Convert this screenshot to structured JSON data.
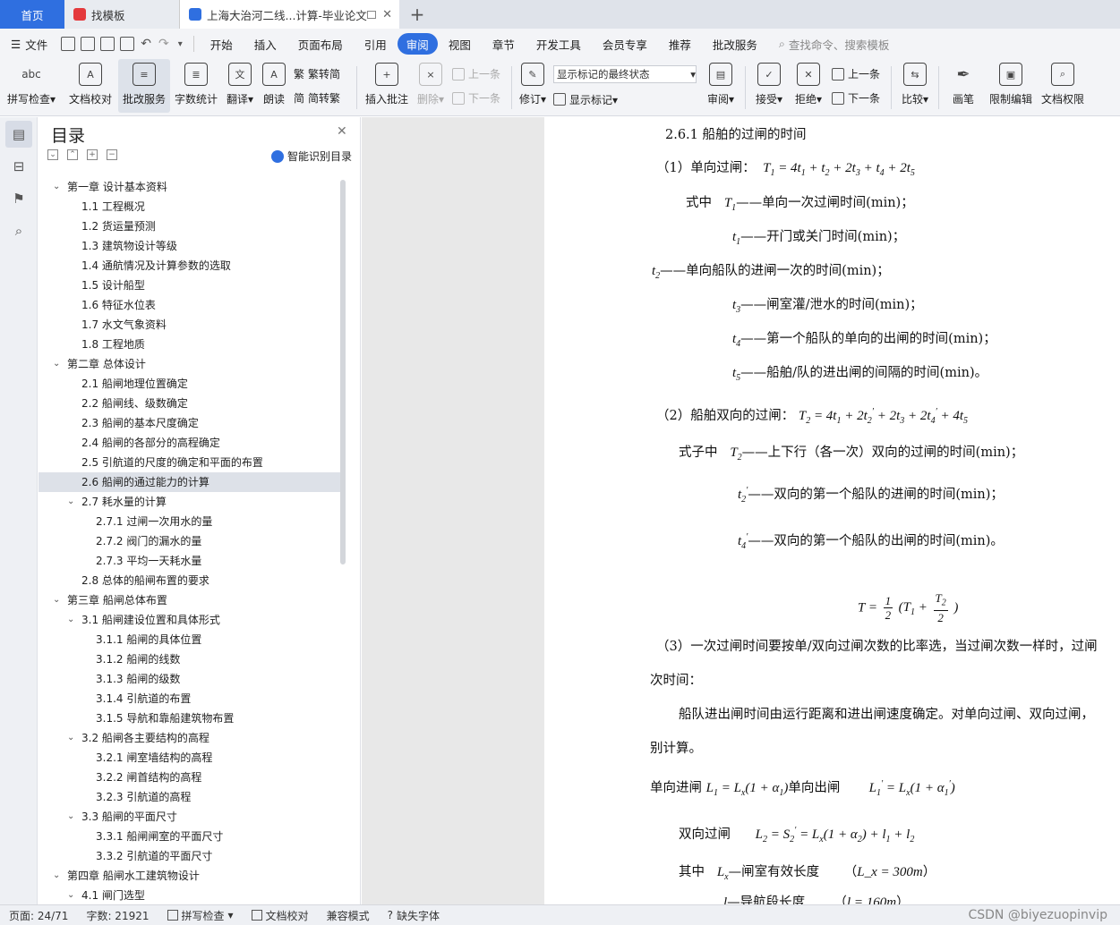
{
  "tabs": [
    {
      "label": "首页"
    },
    {
      "label": "找模板"
    },
    {
      "label": "上海大治河二线...计算-毕业论文"
    }
  ],
  "menu": {
    "file_label": "文件",
    "items": [
      "开始",
      "插入",
      "页面布局",
      "引用",
      "审阅",
      "视图",
      "章节",
      "开发工具",
      "会员专享",
      "推荐",
      "批改服务"
    ],
    "active": "审阅",
    "search_placeholder": "查找命令、搜索模板"
  },
  "ribbon": {
    "spellcheck": "拼写检查",
    "spellcheck_icon_text": "abc",
    "doc_proof": "文档校对",
    "correction_service": "批改服务",
    "word_count": "字数统计",
    "translate": "翻译",
    "read_aloud": "朗读",
    "trad_to_simp": "繁转简",
    "simp_to_trad": "简转繁",
    "insert_comment": "插入批注",
    "delete": "删除",
    "prev": "上一条",
    "next": "下一条",
    "revise": "修订",
    "markup_state": "显示标记的最终状态",
    "show_markup": "显示标记",
    "review": "审阅",
    "accept": "接受",
    "reject": "拒绝",
    "prev2": "上一条",
    "next2": "下一条",
    "compare": "比较",
    "pen": "画笔",
    "restrict_edit": "限制编辑",
    "doc_permission": "文档权限"
  },
  "toc": {
    "title": "目录",
    "smart_label": "智能识别目录",
    "items": [
      {
        "label": "第一章  设计基本资料",
        "level": 0,
        "arrow": "down"
      },
      {
        "label": "1.1 工程概况",
        "level": 1
      },
      {
        "label": "1.2 货运量预测",
        "level": 1
      },
      {
        "label": "1.3 建筑物设计等级",
        "level": 1
      },
      {
        "label": "1.4 通航情况及计算参数的选取",
        "level": 1
      },
      {
        "label": "1.5 设计船型",
        "level": 1
      },
      {
        "label": "1.6 特征水位表",
        "level": 1
      },
      {
        "label": "1.7 水文气象资料",
        "level": 1
      },
      {
        "label": "1.8 工程地质",
        "level": 1
      },
      {
        "label": "第二章  总体设计",
        "level": 0,
        "arrow": "down"
      },
      {
        "label": "2.1 船闸地理位置确定",
        "level": 1
      },
      {
        "label": "2.2 船闸线、级数确定",
        "level": 1
      },
      {
        "label": "2.3 船闸的基本尺度确定",
        "level": 1
      },
      {
        "label": "2.4 船闸的各部分的高程确定",
        "level": 1
      },
      {
        "label": "2.5 引航道的尺度的确定和平面的布置",
        "level": 1
      },
      {
        "label": "2.6 船闸的通过能力的计算",
        "level": 1,
        "selected": true
      },
      {
        "label": "2.7 耗水量的计算",
        "level": 1,
        "arrow": "down"
      },
      {
        "label": "2.7.1 过闸一次用水的量",
        "level": 2
      },
      {
        "label": "2.7.2 阀门的漏水的量",
        "level": 2
      },
      {
        "label": "2.7.3 平均一天耗水量",
        "level": 2
      },
      {
        "label": "2.8 总体的船闸布置的要求",
        "level": 1
      },
      {
        "label": "第三章  船闸总体布置",
        "level": 0,
        "arrow": "down"
      },
      {
        "label": "3.1 船闸建设位置和具体形式",
        "level": 1,
        "arrow": "down"
      },
      {
        "label": "3.1.1 船闸的具体位置",
        "level": 2
      },
      {
        "label": "3.1.2 船闸的线数",
        "level": 2
      },
      {
        "label": "3.1.3 船闸的级数",
        "level": 2
      },
      {
        "label": "3.1.4 引航道的布置",
        "level": 2
      },
      {
        "label": "3.1.5 导航和靠船建筑物布置",
        "level": 2
      },
      {
        "label": "3.2 船闸各主要结构的高程",
        "level": 1,
        "arrow": "down"
      },
      {
        "label": "3.2.1 闸室墙结构的高程",
        "level": 2
      },
      {
        "label": "3.2.2 闸首结构的高程",
        "level": 2
      },
      {
        "label": "3.2.3 引航道的高程",
        "level": 2
      },
      {
        "label": "3.3 船闸的平面尺寸",
        "level": 1,
        "arrow": "down"
      },
      {
        "label": "3.3.1 船闸闸室的平面尺寸",
        "level": 2
      },
      {
        "label": "3.3.2 引航道的平面尺寸",
        "level": 2
      },
      {
        "label": "第四章  船闸水工建筑物设计",
        "level": 0,
        "arrow": "down"
      },
      {
        "label": "4.1 闸门选型",
        "level": 1,
        "arrow": "down"
      }
    ]
  },
  "doc": {
    "heading": "2.6.1  船舶的过闸的时间",
    "p1_prefix": "（1）单向过闸：",
    "p1_eq": "T₁ = 4t₁ + t₂ + 2t₃ + t₄ + 2t₅",
    "where1": "式中",
    "d_T1": "——单向一次过闸时间(min)；",
    "d_t1": "——开门或关门时间(min)；",
    "d_t2": "——单向船队的进闸一次的时间(min)；",
    "d_t3": "——闸室灌/泄水的时间(min)；",
    "d_t4": "——第一个船队的单向的出闸的时间(min)；",
    "d_t5": "——船舶/队的进出闸的间隔的时间(min)。",
    "p2_prefix": "（2）船舶双向的过闸：",
    "where2": "式子中",
    "d_T2": "——上下行（各一次）双向的过闸的时间(min)；",
    "d_t2p": "——双向的第一个船队的进闸的时间(min)；",
    "d_t4p": "——双向的第一个船队的出闸的时间(min)。",
    "p3_line1": "（3）一次过闸时间要按单/双向过闸次数的比率选，当过闸次数一样时，过闸",
    "p3_line2": "次时间：",
    "p4_line1": "船队进出闸时间由运行距离和进出闸速度确定。对单向过闸、双向过闸，",
    "p4_line2": "别计算。",
    "in_single": "单向进闸",
    "out_single": "单向出闸",
    "two_way": "双向过闸",
    "among": "其中",
    "lx_desc": "—闸室有效长度",
    "lx_val": "L_x = 300m",
    "l1_desc": "—导航段长度",
    "l1_val": "l = 160m"
  },
  "status": {
    "page": "页面: 24/71",
    "words": "字数: 21921",
    "spellcheck": "拼写检查",
    "proof": "文档校对",
    "compat": "兼容模式",
    "missing_font": "缺失字体",
    "watermark": "CSDN @biyezuopinvip"
  }
}
